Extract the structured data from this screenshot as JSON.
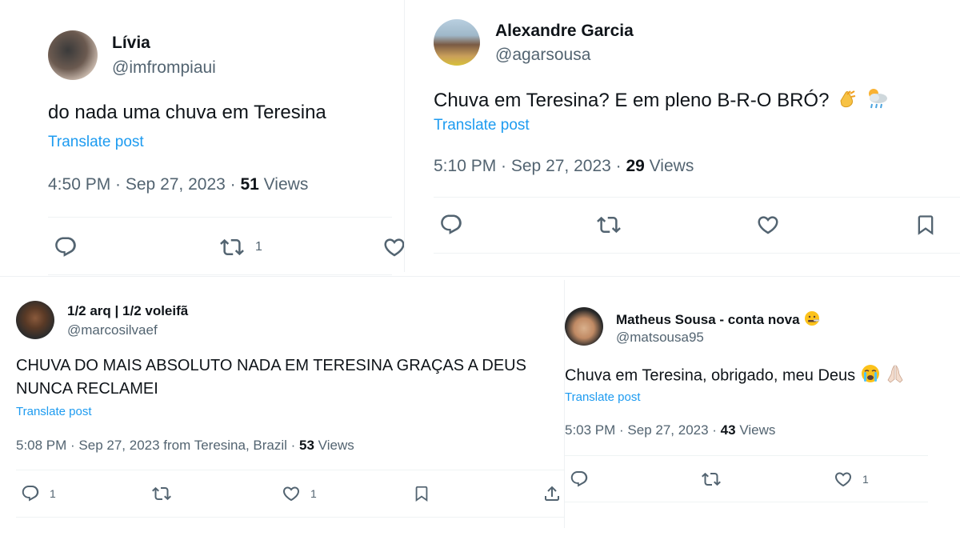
{
  "tweets": [
    {
      "name": "Lívia",
      "handle": "@imfrompiaui",
      "text": "do nada uma chuva em Teresina",
      "translate": "Translate post",
      "meta_prefix": "4:50 PM · Sep 27, 2023 · ",
      "views_count": "51",
      "views_label": " Views",
      "retweets": "1"
    },
    {
      "name": "Alexandre Garcia",
      "handle": "@agarsousa",
      "text": "Chuva em Teresina? E em pleno B-R-O BRÓ?",
      "emojis": [
        "clapping-hands",
        "sun-behind-rain-cloud"
      ],
      "translate": "Translate post",
      "meta_prefix": "5:10 PM · Sep 27, 2023 · ",
      "views_count": "29",
      "views_label": " Views"
    },
    {
      "name": "1/2 arq | 1/2 voleifã",
      "handle": "@marcosilvaef",
      "text_line1": "CHUVA DO MAIS ABSOLUTO NADA EM TERESINA GRAÇAS A DEUS",
      "text_line2": "NUNCA RECLAMEI",
      "translate": "Translate post",
      "meta_prefix": "5:08 PM · Sep 27, 2023 from Teresina, Brazil · ",
      "views_count": "53",
      "views_label": " Views",
      "replies": "1",
      "likes": "1"
    },
    {
      "name": "Matheus Sousa - conta nova",
      "name_emoji": "face-with-thermometer",
      "handle": "@matsousa95",
      "text": "Chuva em Teresina, obrigado, meu Deus",
      "emojis": [
        "loudly-crying-face",
        "folded-hands"
      ],
      "translate": "Translate post",
      "meta_prefix": "5:03 PM · Sep 27, 2023 · ",
      "views_count": "43",
      "views_label": " Views",
      "likes": "1"
    }
  ],
  "icons": [
    "reply-icon",
    "retweet-icon",
    "like-icon",
    "bookmark-icon",
    "share-icon"
  ],
  "colors": {
    "link": "#1d9bf0",
    "secondary": "#536471",
    "primary": "#0f1419",
    "divider": "#eff3f4"
  }
}
